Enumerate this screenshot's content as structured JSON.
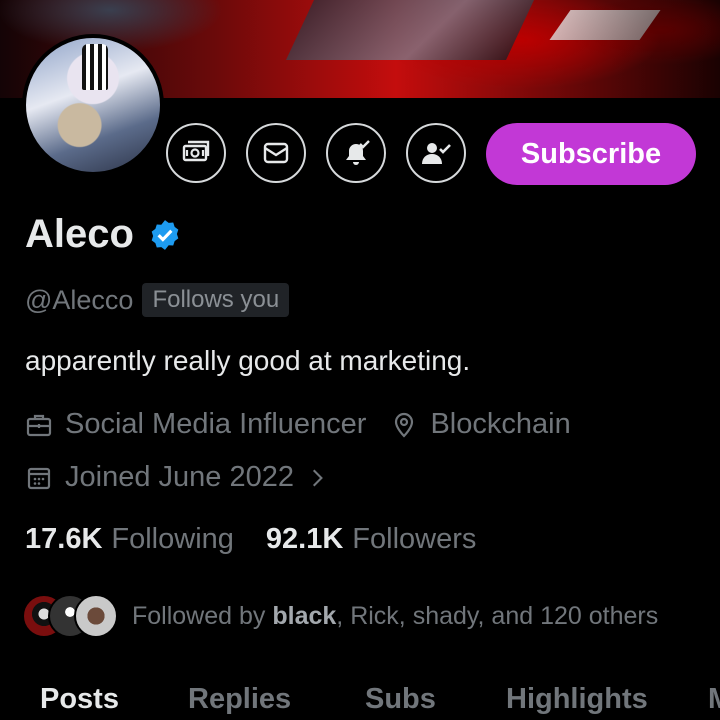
{
  "profile": {
    "name": "Aleco",
    "handle": "@Alecco",
    "follows_you": "Follows you",
    "bio": "apparently really good at marketing.",
    "category": "Social Media Influencer",
    "location": "Blockchain",
    "joined": "Joined June 2022"
  },
  "actions": {
    "subscribe_label": "Subscribe",
    "icons": [
      "money-icon",
      "mail-icon",
      "bell-icon",
      "follow-check-icon"
    ]
  },
  "stats": {
    "following_count": "17.6K",
    "following_label": "Following",
    "followers_count": "92.1K",
    "followers_label": "Followers"
  },
  "followed_by": {
    "prefix": "Followed by ",
    "bold_name": "black",
    "rest": ", Rick, shady, and 120 others"
  },
  "tabs": [
    "Posts",
    "Replies",
    "Subs",
    "Highlights",
    "M"
  ],
  "colors": {
    "accent": "#c238d6",
    "verified": "#1d9bf0",
    "background": "#000000",
    "muted_text": "#71767b"
  }
}
